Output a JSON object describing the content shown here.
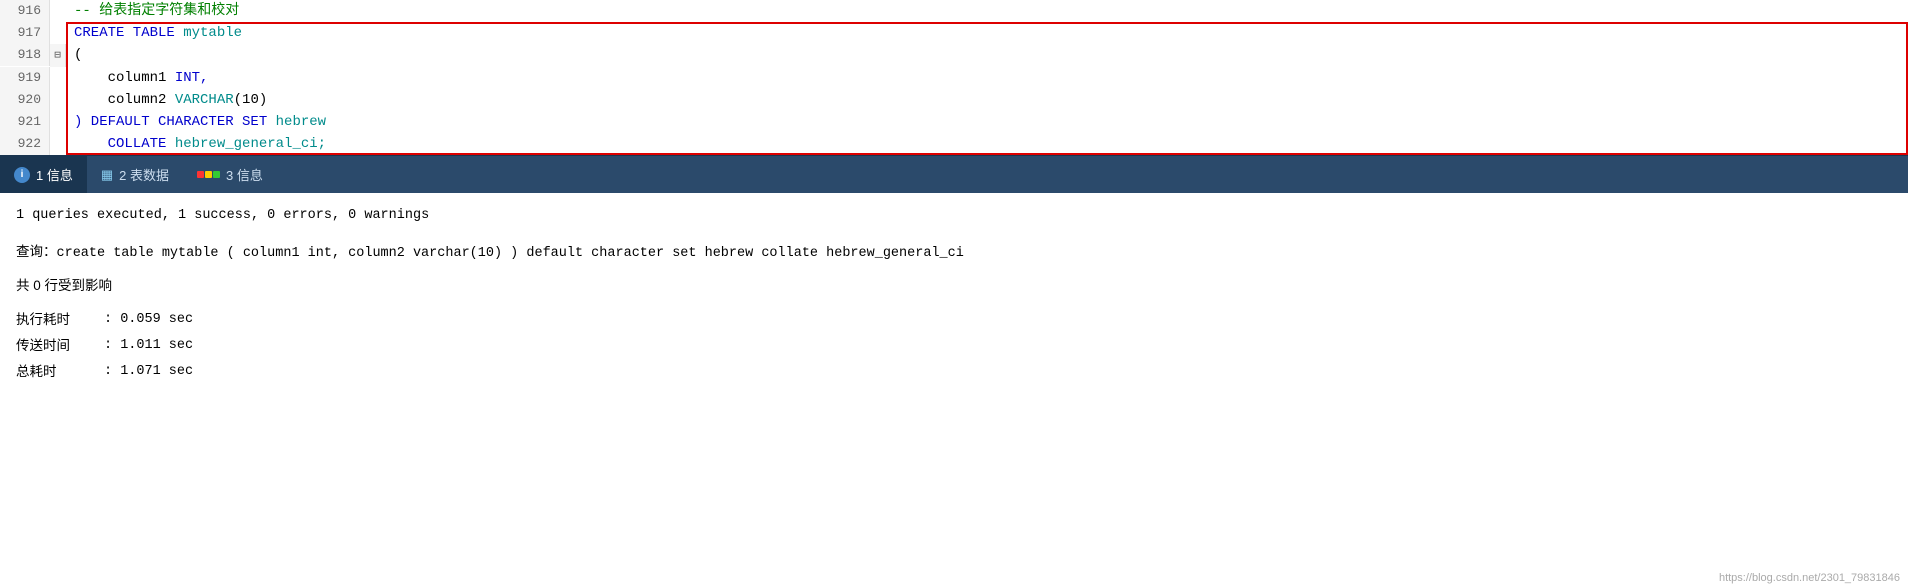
{
  "editor": {
    "lines": [
      {
        "number": "916",
        "fold": "",
        "content": "-- 给表指定字符集和校对",
        "type": "comment"
      },
      {
        "number": "917",
        "fold": "",
        "content_parts": [
          {
            "text": "CREATE TABLE ",
            "class": "kw-blue"
          },
          {
            "text": "mytable",
            "class": "kw-cyan"
          }
        ],
        "type": "highlighted"
      },
      {
        "number": "918",
        "fold": "⊟",
        "content_parts": [
          {
            "text": "(",
            "class": "text-normal"
          }
        ],
        "type": "highlighted"
      },
      {
        "number": "919",
        "fold": "",
        "content_parts": [
          {
            "text": "    column1 ",
            "class": "text-normal"
          },
          {
            "text": "INT,",
            "class": "kw-blue"
          }
        ],
        "type": "highlighted"
      },
      {
        "number": "920",
        "fold": "",
        "content_parts": [
          {
            "text": "    column2 ",
            "class": "text-normal"
          },
          {
            "text": "VARCHAR",
            "class": "kw-cyan"
          },
          {
            "text": "(10)",
            "class": "text-normal"
          }
        ],
        "type": "highlighted"
      },
      {
        "number": "921",
        "fold": "",
        "content_parts": [
          {
            "text": ") ",
            "class": "kw-blue"
          },
          {
            "text": "DEFAULT CHARACTER SET ",
            "class": "kw-blue"
          },
          {
            "text": "hebrew",
            "class": "kw-cyan"
          }
        ],
        "type": "highlighted"
      },
      {
        "number": "922",
        "fold": "",
        "content_parts": [
          {
            "text": "    COLLATE ",
            "class": "kw-blue"
          },
          {
            "text": "hebrew_general_ci;",
            "class": "kw-cyan"
          }
        ],
        "type": "highlighted"
      }
    ]
  },
  "tabs": [
    {
      "id": "1",
      "label": "1 信息",
      "icon_type": "info",
      "active": true
    },
    {
      "id": "2",
      "label": "2 表数据",
      "icon_type": "table",
      "active": false
    },
    {
      "id": "3",
      "label": "3 信息",
      "icon_type": "warning",
      "active": false
    }
  ],
  "results": {
    "summary": "1 queries executed, 1 success, 0 errors, 0 warnings",
    "query_label": "查询：",
    "query_text": "create table mytable ( column1 int, column2 varchar(10) ) default character set hebrew collate hebrew_general_ci",
    "affected_label": "共 0 行受到影响",
    "timings": [
      {
        "label": "执行耗时",
        "value": ": 0.059 sec"
      },
      {
        "label": "传送时间",
        "value": ": 1.011 sec"
      },
      {
        "label": "总耗时",
        "value": ": 1.071 sec"
      }
    ]
  },
  "watermark": "https://blog.csdn.net/2301_79831846"
}
